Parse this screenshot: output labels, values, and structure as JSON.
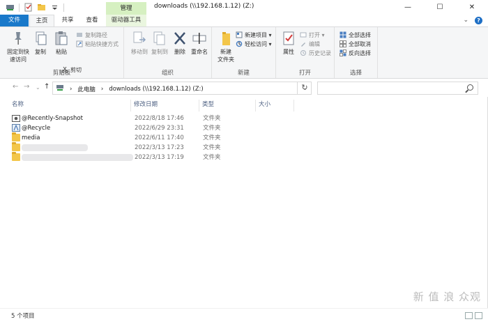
{
  "titlebar": {
    "title": "downloads (\\\\192.168.1.12) (Z:)",
    "context_tab_header": "管理",
    "min": "—",
    "max": "☐",
    "close": "✕"
  },
  "tabs": {
    "file": "文件",
    "home": "主页",
    "share": "共享",
    "view": "查看",
    "drive_tools": "驱动器工具",
    "expand": "⌄",
    "help": "?"
  },
  "ribbon": {
    "clipboard": {
      "label": "剪贴板",
      "pin": "固定到快\n速访问",
      "copy": "复制",
      "paste": "粘贴",
      "cut": "剪切",
      "copy_path": "复制路径",
      "paste_shortcut": "粘贴快捷方式"
    },
    "organize": {
      "label": "组织",
      "move_to": "移动到",
      "copy_to": "复制到",
      "delete": "删除",
      "rename": "重命名"
    },
    "new": {
      "label": "新建",
      "new_folder": "新建\n文件夹",
      "new_item": "新建项目 ▾",
      "easy_access": "轻松访问 ▾"
    },
    "open": {
      "label": "打开",
      "properties": "属性",
      "open": "打开 ▾",
      "edit": "编辑",
      "history": "历史记录"
    },
    "select": {
      "label": "选择",
      "select_all": "全部选择",
      "select_none": "全部取消",
      "invert": "反向选择"
    }
  },
  "address": {
    "crumb_pc": "此电脑",
    "crumb_sep": "›",
    "crumb_folder": "downloads (\\\\192.168.1.12) (Z:)",
    "search_placeholder": ""
  },
  "columns": {
    "name": "名称",
    "modified": "修改日期",
    "type": "类型",
    "size": "大小"
  },
  "files": [
    {
      "name": "@Recently-Snapshot",
      "modified": "2022/8/18 17:46",
      "type": "文件夹",
      "icon": "snapshot-folder-icon"
    },
    {
      "name": "@Recycle",
      "modified": "2022/6/29 23:31",
      "type": "文件夹",
      "icon": "recycle-folder-icon"
    },
    {
      "name": "media",
      "modified": "2022/6/11 17:40",
      "type": "文件夹",
      "icon": "folder-icon"
    },
    {
      "name": "",
      "modified": "2022/3/13 17:23",
      "type": "文件夹",
      "icon": "folder-icon"
    },
    {
      "name": "",
      "modified": "2022/3/13 17:19",
      "type": "文件夹",
      "icon": "folder-icon"
    }
  ],
  "status": {
    "count": "5 个项目"
  },
  "watermark": "新 值 浪 众观"
}
